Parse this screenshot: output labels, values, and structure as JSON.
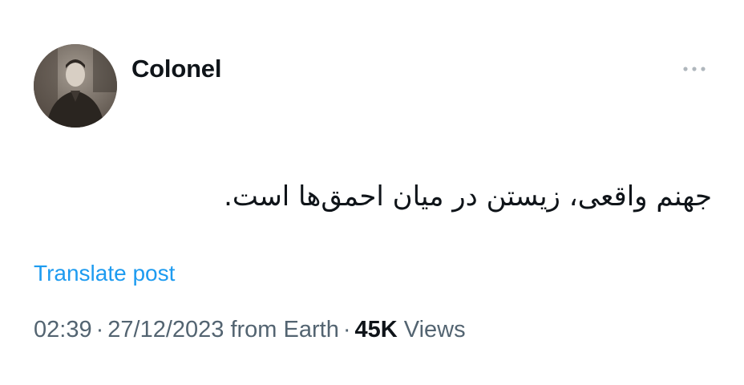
{
  "author": {
    "display_name": "Colonel"
  },
  "post": {
    "text": "جهنم واقعی، زیستن در میان احمق‌ها است.",
    "translate_label": "Translate post",
    "time": "02:39",
    "date": "27/12/2023",
    "source": "from Earth",
    "separator": "·",
    "views_count": "45K",
    "views_label": "Views"
  },
  "icons": {
    "more": "more-horizontal-icon"
  },
  "colors": {
    "link": "#1d9bf0",
    "secondary_text": "#536471",
    "primary_text": "#0f1419"
  }
}
